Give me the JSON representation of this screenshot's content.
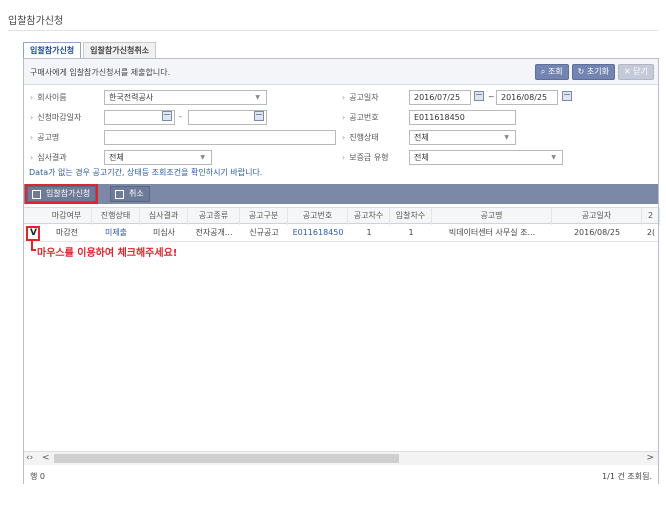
{
  "page": {
    "title": "입찰참가신청"
  },
  "tabs": [
    {
      "label": "입찰참가신청",
      "active": true
    },
    {
      "label": "입찰참가신청취소",
      "active": false
    }
  ],
  "header": {
    "message": "구매사에게 입찰참가신청서를 제출합니다.",
    "buttons": {
      "search": "조회",
      "reset": "초기화",
      "close": "닫기"
    }
  },
  "form": {
    "buyer_label": "회사이름",
    "buyer_value": "한국전력공사",
    "deadline_label": "신청마감일자",
    "deadline_from": "",
    "deadline_to": "",
    "notice_name_label": "공고명",
    "notice_name_value": "",
    "review_label": "심사결과",
    "review_value": "전체",
    "notice_date_label": "공고일자",
    "notice_date_from": "2016/07/25",
    "notice_date_to": "2016/08/25",
    "notice_no_label": "공고번호",
    "notice_no_value": "E011618450",
    "progress_label": "진행상태",
    "progress_value": "전체",
    "deposit_label": "보증금 유형",
    "deposit_value": "전체",
    "separator": "~",
    "range_dash": "-"
  },
  "note": "Data가 없는 경우 공고기간, 상태등 조회조건을 확인하시기 바랍니다.",
  "actions": {
    "apply": "입찰참가신청",
    "cancel": "취소"
  },
  "grid": {
    "columns": [
      "마감여부",
      "진행상태",
      "심사결과",
      "공고종류",
      "공고구분",
      "공고번호",
      "공고차수",
      "입찰차수",
      "공고명",
      "공고일자",
      "2"
    ],
    "rows": [
      [
        "마감전",
        "미제출",
        "미심사",
        "전자공개...",
        "신규공고",
        "E011618450",
        "1",
        "1",
        "빅데이터센터 사무실 조...",
        "2016/08/25",
        "2("
      ]
    ],
    "check_mark": "V"
  },
  "callout": "마우스를 이용하여 체크해주세요!",
  "footer": {
    "row_count": "행 0",
    "page_info": "1/1 건 조회됨."
  },
  "colors": {
    "accent_red": "#e0252d",
    "link_blue": "#2d5aa8",
    "toolbar": "#7b89a6"
  }
}
